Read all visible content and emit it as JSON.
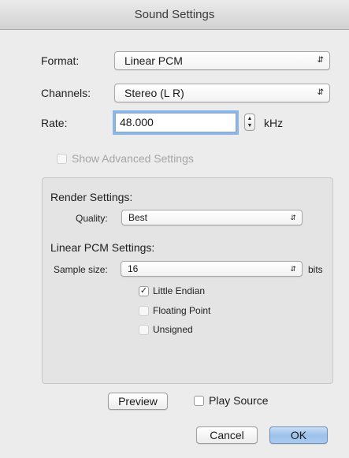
{
  "window": {
    "title": "Sound Settings"
  },
  "format": {
    "label": "Format:",
    "value": "Linear PCM"
  },
  "channels": {
    "label": "Channels:",
    "value": "Stereo (L R)"
  },
  "rate": {
    "label": "Rate:",
    "value": "48.000",
    "unit": "kHz"
  },
  "advanced": {
    "label": "Show Advanced Settings",
    "checked": false,
    "enabled": false
  },
  "render_settings": {
    "title": "Render Settings:",
    "quality_label": "Quality:",
    "quality_value": "Best"
  },
  "linear_pcm_settings": {
    "title": "Linear PCM Settings:",
    "sample_size_label": "Sample size:",
    "sample_size_value": "16",
    "sample_size_unit": "bits",
    "options": [
      {
        "label": "Little Endian",
        "checked": true,
        "enabled": true
      },
      {
        "label": "Floating Point",
        "checked": false,
        "enabled": false
      },
      {
        "label": "Unsigned",
        "checked": false,
        "enabled": false
      }
    ]
  },
  "footer": {
    "preview_label": "Preview",
    "play_source_label": "Play Source",
    "play_source_checked": false,
    "cancel_label": "Cancel",
    "ok_label": "OK"
  },
  "icons": {
    "popup_arrows": "up-down-arrows-icon",
    "checkmark": "checkmark-icon"
  },
  "colors": {
    "focus_ring": "#8ab6ea",
    "default_button": "#a8caf0",
    "window_bg": "#ececec"
  }
}
